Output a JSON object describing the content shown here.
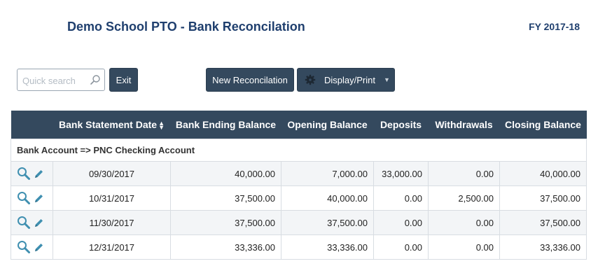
{
  "header": {
    "title": "Demo School PTO - Bank Reconcilation",
    "fiscal_year": "FY 2017-18"
  },
  "toolbar": {
    "search_placeholder": "Quick search",
    "exit_label": "Exit",
    "new_reconciliation_label": "New Reconcilation",
    "display_print_label": "Display/Print"
  },
  "table": {
    "columns": {
      "actions": "",
      "statement_date": "Bank Statement Date",
      "ending_balance": "Bank Ending Balance",
      "opening_balance": "Opening Balance",
      "deposits": "Deposits",
      "withdrawals": "Withdrawals",
      "closing_balance": "Closing Balance"
    },
    "group_label": "Bank Account => PNC Checking Account",
    "rows": [
      {
        "statement_date": "09/30/2017",
        "ending_balance": "40,000.00",
        "opening_balance": "7,000.00",
        "deposits": "33,000.00",
        "withdrawals": "0.00",
        "closing_balance": "40,000.00"
      },
      {
        "statement_date": "10/31/2017",
        "ending_balance": "37,500.00",
        "opening_balance": "40,000.00",
        "deposits": "0.00",
        "withdrawals": "2,500.00",
        "closing_balance": "37,500.00"
      },
      {
        "statement_date": "11/30/2017",
        "ending_balance": "37,500.00",
        "opening_balance": "37,500.00",
        "deposits": "0.00",
        "withdrawals": "0.00",
        "closing_balance": "37,500.00"
      },
      {
        "statement_date": "12/31/2017",
        "ending_balance": "33,336.00",
        "opening_balance": "33,336.00",
        "deposits": "0.00",
        "withdrawals": "0.00",
        "closing_balance": "33,336.00"
      }
    ]
  },
  "icons": {
    "search": "search-icon",
    "gear": "gear-icon",
    "caret": "caret-down-icon",
    "sort": "sort-icon",
    "view": "magnifier-icon",
    "edit": "pencil-icon"
  },
  "colors": {
    "title": "#1f3f6e",
    "header_bg": "#34495e",
    "button_bg": "#34495e",
    "icon_teal": "#3f8fb0"
  }
}
